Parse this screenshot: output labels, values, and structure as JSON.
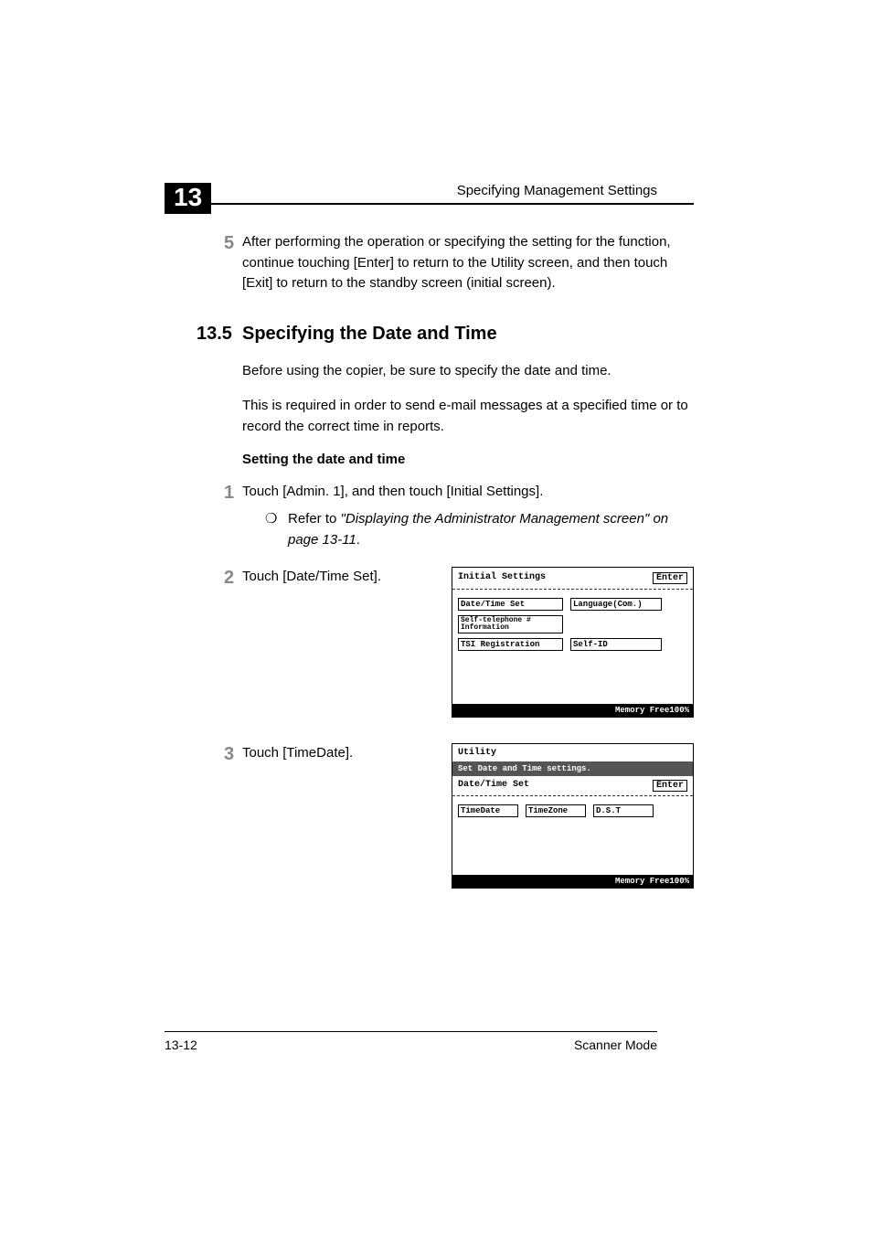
{
  "header": {
    "chapter_num": "13",
    "title": "Specifying Management Settings"
  },
  "step5": {
    "num": "5",
    "text": "After performing the operation or specifying the setting for the function, continue touching [Enter] to return to the Utility screen, and then touch [Exit] to return to the standby screen (initial screen)."
  },
  "section": {
    "num": "13.5",
    "heading": "Specifying the Date and Time",
    "para1": "Before using the copier, be sure to specify the date and time.",
    "para2": "This is required in order to send e-mail messages at a specified time or to record the correct time in reports.",
    "sub_heading": "Setting the date and time"
  },
  "step1": {
    "num": "1",
    "text": "Touch [Admin. 1], and then touch [Initial Settings].",
    "bullet_sym": "❍",
    "bullet_prefix": "Refer to ",
    "bullet_italic": "\"Displaying the Administrator Management screen\" on page 13-11",
    "bullet_suffix": "."
  },
  "step2": {
    "num": "2",
    "text": "Touch [Date/Time Set]."
  },
  "step3": {
    "num": "3",
    "text": "Touch [TimeDate]."
  },
  "screen1": {
    "title": "Initial Settings",
    "enter": "Enter",
    "btn_date": "Date/Time Set",
    "btn_lang": "Language(Com.)",
    "btn_self_tel": "Self-telephone # Information",
    "btn_tsi": "TSI Registration",
    "btn_selfid": "Self-ID",
    "footer_label": "Memory Free",
    "footer_val": "100%"
  },
  "screen2": {
    "head": "Utility",
    "msg": "Set Date and Time settings.",
    "sub_title": "Date/Time Set",
    "enter": "Enter",
    "btn_timedate": "TimeDate",
    "btn_timezone": "TimeZone",
    "btn_dst": "D.S.T",
    "footer_label": "Memory Free",
    "footer_val": "100%"
  },
  "footer": {
    "page": "13-12",
    "label": "Scanner Mode"
  }
}
